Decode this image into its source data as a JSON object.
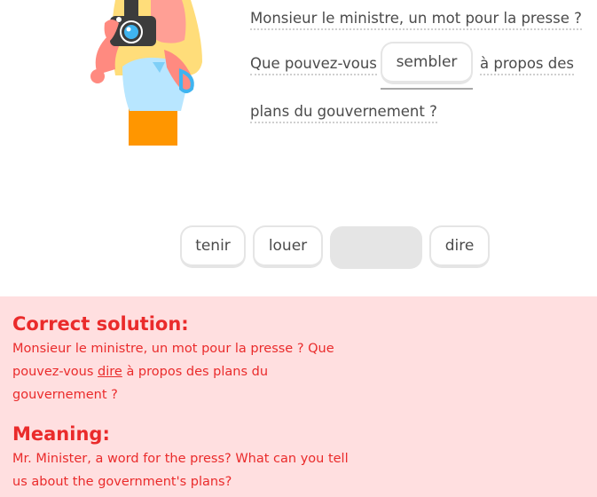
{
  "exercise": {
    "sentence": {
      "line1": "Monsieur le ministre, un mot pour la presse ?",
      "line2_before": "Que pouvez-vous",
      "line2_after": "à propos des",
      "line3": "plans du gouvernement ?"
    },
    "selected_answer": "sembler"
  },
  "word_bank": {
    "options": [
      "tenir",
      "louer",
      "dire"
    ]
  },
  "feedback": {
    "solution_heading": "Correct solution:",
    "solution_line1": "Monsieur le ministre, un mot pour la presse ? Que",
    "solution_line2_before": "pouvez-vous",
    "solution_line2_highlight": "dire",
    "solution_line2_after": "à propos des plans du",
    "solution_line3": "gouvernement ?",
    "meaning_heading": "Meaning:",
    "meaning_line1": "Mr. Minister, a word for the press? What can you tell",
    "meaning_line2": "us about the government's plans?"
  },
  "colors": {
    "feedback_background": "#ffdfe0",
    "feedback_text": "#ea2b2b",
    "hair": "#ffdd7a",
    "shirt": "#b8e6ff",
    "pants": "#ff9600",
    "skin": "#ff8a80",
    "camera": "#3c3c3c",
    "lens": "#3fb4f0"
  }
}
